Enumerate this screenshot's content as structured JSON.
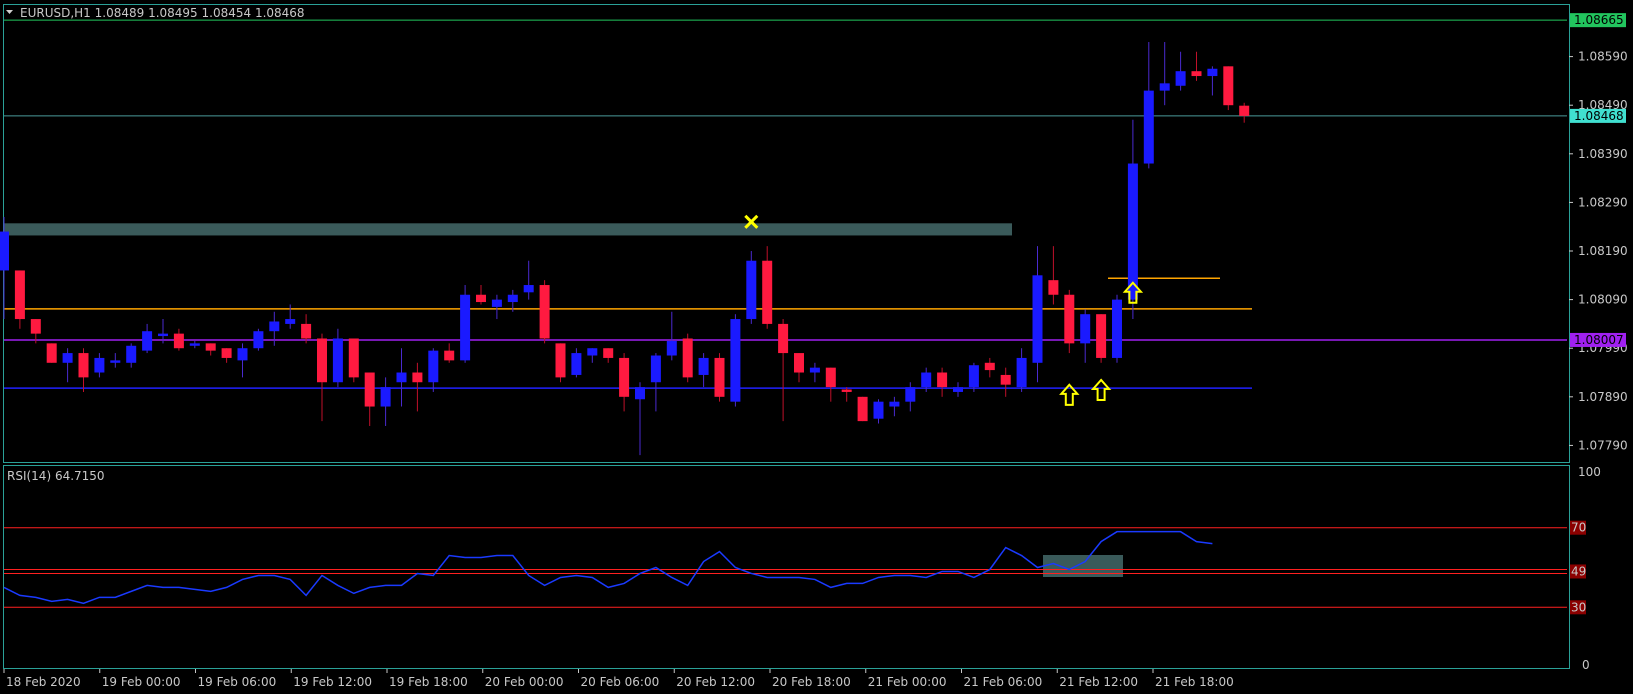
{
  "header": {
    "symbol_line": "EURUSD,H1  1.08489 1.08495 1.08454 1.08468"
  },
  "colors": {
    "background": "#000000",
    "bull_candle": "#1a1aff",
    "bear_candle": "#ff1a40",
    "grid_frame": "#2aa198",
    "support_resistance_zone": "#3a5a5a",
    "orange_level": "#ffa500",
    "purple_level": "#a020f0",
    "blue_level": "#2020ff",
    "bid_line": "#4a9a9a",
    "rsi_line": "#1a3aff",
    "rsi_levels": "#ff2020",
    "arrow_markers": "#ffff00"
  },
  "price_axis": {
    "ticks": [
      "1.08590",
      "1.08490",
      "1.08390",
      "1.08290",
      "1.08190",
      "1.08090",
      "1.07990",
      "1.07890",
      "1.07790"
    ],
    "badges": [
      {
        "label": "1.08665",
        "value": 1.08665,
        "color": "#22c55e"
      },
      {
        "label": "1.08468",
        "value": 1.08468,
        "color": "#40e0d0"
      },
      {
        "label": "1.08007",
        "value": 1.08007,
        "color": "#a020f0"
      }
    ]
  },
  "time_axis": {
    "labels": [
      "18 Feb 2020",
      "19 Feb 00:00",
      "19 Feb 06:00",
      "19 Feb 12:00",
      "19 Feb 18:00",
      "20 Feb 00:00",
      "20 Feb 06:00",
      "20 Feb 12:00",
      "20 Feb 18:00",
      "21 Feb 00:00",
      "21 Feb 06:00",
      "21 Feb 12:00",
      "21 Feb 18:00"
    ]
  },
  "rsi_panel": {
    "label": "RSI(14) 64.7150",
    "scale_ticks": [
      "100",
      "0"
    ],
    "level_badges": [
      "70",
      "49",
      "30"
    ]
  },
  "chart_data": [
    {
      "type": "candlestick",
      "title": "EURUSD,H1",
      "timeframe": "H1",
      "ylim": [
        1.0776,
        1.0869
      ],
      "levels": {
        "green_top": 1.08665,
        "bid": 1.08468,
        "zone": [
          1.08222,
          1.08247
        ],
        "orange": 1.08071,
        "purple": 1.08007,
        "blue": 1.07908,
        "orange_short": 1.08134
      },
      "candles": [
        {
          "t": "18 Feb 17:00",
          "o": 1.0815,
          "h": 1.0826,
          "l": 1.0805,
          "c": 1.0823
        },
        {
          "t": "18 Feb 18:00",
          "o": 1.0815,
          "h": 1.0815,
          "l": 1.0803,
          "c": 1.0805
        },
        {
          "t": "18 Feb 19:00",
          "o": 1.0805,
          "h": 1.0805,
          "l": 1.08,
          "c": 1.0802
        },
        {
          "t": "18 Feb 20:00",
          "o": 1.08,
          "h": 1.08,
          "l": 1.0796,
          "c": 1.0796
        },
        {
          "t": "18 Feb 21:00",
          "o": 1.0796,
          "h": 1.0799,
          "l": 1.0792,
          "c": 1.0798
        },
        {
          "t": "18 Feb 22:00",
          "o": 1.0798,
          "h": 1.0799,
          "l": 1.079,
          "c": 1.0793
        },
        {
          "t": "18 Feb 23:00",
          "o": 1.0794,
          "h": 1.0798,
          "l": 1.0793,
          "c": 1.0797
        },
        {
          "t": "19 Feb 00:00",
          "o": 1.0796,
          "h": 1.0798,
          "l": 1.0795,
          "c": 1.07965
        },
        {
          "t": "19 Feb 01:00",
          "o": 1.0796,
          "h": 1.08,
          "l": 1.0795,
          "c": 1.07995
        },
        {
          "t": "19 Feb 02:00",
          "o": 1.07985,
          "h": 1.0804,
          "l": 1.0798,
          "c": 1.08025
        },
        {
          "t": "19 Feb 03:00",
          "o": 1.08015,
          "h": 1.0805,
          "l": 1.08,
          "c": 1.0802
        },
        {
          "t": "19 Feb 04:00",
          "o": 1.0802,
          "h": 1.0803,
          "l": 1.07985,
          "c": 1.0799
        },
        {
          "t": "19 Feb 05:00",
          "o": 1.07995,
          "h": 1.08005,
          "l": 1.0799,
          "c": 1.08
        },
        {
          "t": "19 Feb 06:00",
          "o": 1.08,
          "h": 1.08,
          "l": 1.07975,
          "c": 1.07985
        },
        {
          "t": "19 Feb 07:00",
          "o": 1.0799,
          "h": 1.0799,
          "l": 1.0796,
          "c": 1.0797
        },
        {
          "t": "19 Feb 08:00",
          "o": 1.07965,
          "h": 1.08,
          "l": 1.0793,
          "c": 1.0799
        },
        {
          "t": "19 Feb 09:00",
          "o": 1.0799,
          "h": 1.0803,
          "l": 1.07985,
          "c": 1.08025
        },
        {
          "t": "19 Feb 10:00",
          "o": 1.08025,
          "h": 1.08065,
          "l": 1.07995,
          "c": 1.08045
        },
        {
          "t": "19 Feb 11:00",
          "o": 1.0804,
          "h": 1.0808,
          "l": 1.0803,
          "c": 1.0805
        },
        {
          "t": "19 Feb 12:00",
          "o": 1.0804,
          "h": 1.0806,
          "l": 1.08,
          "c": 1.0801
        },
        {
          "t": "19 Feb 13:00",
          "o": 1.0801,
          "h": 1.0802,
          "l": 1.0784,
          "c": 1.0792
        },
        {
          "t": "19 Feb 14:00",
          "o": 1.0792,
          "h": 1.0803,
          "l": 1.0791,
          "c": 1.0801
        },
        {
          "t": "19 Feb 15:00",
          "o": 1.0801,
          "h": 1.0801,
          "l": 1.0792,
          "c": 1.0793
        },
        {
          "t": "19 Feb 16:00",
          "o": 1.0794,
          "h": 1.0794,
          "l": 1.0783,
          "c": 1.0787
        },
        {
          "t": "19 Feb 17:00",
          "o": 1.0787,
          "h": 1.0793,
          "l": 1.0783,
          "c": 1.0791
        },
        {
          "t": "19 Feb 18:00",
          "o": 1.0792,
          "h": 1.0799,
          "l": 1.0787,
          "c": 1.0794
        },
        {
          "t": "19 Feb 19:00",
          "o": 1.0794,
          "h": 1.0796,
          "l": 1.0786,
          "c": 1.0792
        },
        {
          "t": "19 Feb 20:00",
          "o": 1.0792,
          "h": 1.0799,
          "l": 1.079,
          "c": 1.07985
        },
        {
          "t": "19 Feb 21:00",
          "o": 1.07985,
          "h": 1.08,
          "l": 1.0796,
          "c": 1.07965
        },
        {
          "t": "19 Feb 22:00",
          "o": 1.07965,
          "h": 1.0812,
          "l": 1.0796,
          "c": 1.081
        },
        {
          "t": "19 Feb 23:00",
          "o": 1.081,
          "h": 1.0812,
          "l": 1.0808,
          "c": 1.08085
        },
        {
          "t": "20 Feb 00:00",
          "o": 1.08075,
          "h": 1.081,
          "l": 1.0805,
          "c": 1.0809
        },
        {
          "t": "20 Feb 01:00",
          "o": 1.08085,
          "h": 1.0811,
          "l": 1.08065,
          "c": 1.081
        },
        {
          "t": "20 Feb 02:00",
          "o": 1.08105,
          "h": 1.0817,
          "l": 1.0809,
          "c": 1.0812
        },
        {
          "t": "20 Feb 03:00",
          "o": 1.0812,
          "h": 1.0813,
          "l": 1.08,
          "c": 1.0801
        },
        {
          "t": "20 Feb 04:00",
          "o": 1.08,
          "h": 1.08,
          "l": 1.0792,
          "c": 1.0793
        },
        {
          "t": "20 Feb 05:00",
          "o": 1.07935,
          "h": 1.0799,
          "l": 1.0793,
          "c": 1.0798
        },
        {
          "t": "20 Feb 06:00",
          "o": 1.07975,
          "h": 1.0799,
          "l": 1.0796,
          "c": 1.0799
        },
        {
          "t": "20 Feb 07:00",
          "o": 1.0799,
          "h": 1.0799,
          "l": 1.0796,
          "c": 1.0797
        },
        {
          "t": "20 Feb 08:00",
          "o": 1.0797,
          "h": 1.0798,
          "l": 1.0786,
          "c": 1.0789
        },
        {
          "t": "20 Feb 09:00",
          "o": 1.07885,
          "h": 1.0792,
          "l": 1.0777,
          "c": 1.0791
        },
        {
          "t": "20 Feb 10:00",
          "o": 1.0792,
          "h": 1.0798,
          "l": 1.0786,
          "c": 1.07975
        },
        {
          "t": "20 Feb 11:00",
          "o": 1.07975,
          "h": 1.08065,
          "l": 1.07965,
          "c": 1.08005
        },
        {
          "t": "20 Feb 12:00",
          "o": 1.0801,
          "h": 1.0802,
          "l": 1.0792,
          "c": 1.0793
        },
        {
          "t": "20 Feb 13:00",
          "o": 1.07935,
          "h": 1.0798,
          "l": 1.0791,
          "c": 1.0797
        },
        {
          "t": "20 Feb 14:00",
          "o": 1.0797,
          "h": 1.0798,
          "l": 1.0788,
          "c": 1.0789
        },
        {
          "t": "20 Feb 15:00",
          "o": 1.0788,
          "h": 1.0806,
          "l": 1.0787,
          "c": 1.0805
        },
        {
          "t": "20 Feb 16:00",
          "o": 1.0805,
          "h": 1.0819,
          "l": 1.0804,
          "c": 1.0817
        },
        {
          "t": "20 Feb 17:00",
          "o": 1.0817,
          "h": 1.082,
          "l": 1.0803,
          "c": 1.0804
        },
        {
          "t": "20 Feb 18:00",
          "o": 1.0804,
          "h": 1.0805,
          "l": 1.0784,
          "c": 1.0798
        },
        {
          "t": "20 Feb 19:00",
          "o": 1.0798,
          "h": 1.0798,
          "l": 1.0792,
          "c": 1.0794
        },
        {
          "t": "20 Feb 20:00",
          "o": 1.0794,
          "h": 1.0796,
          "l": 1.0792,
          "c": 1.0795
        },
        {
          "t": "20 Feb 21:00",
          "o": 1.0795,
          "h": 1.0795,
          "l": 1.0788,
          "c": 1.0791
        },
        {
          "t": "20 Feb 22:00",
          "o": 1.07905,
          "h": 1.0791,
          "l": 1.0788,
          "c": 1.079
        },
        {
          "t": "20 Feb 23:00",
          "o": 1.0789,
          "h": 1.0789,
          "l": 1.0784,
          "c": 1.0784
        },
        {
          "t": "21 Feb 00:00",
          "o": 1.07845,
          "h": 1.07885,
          "l": 1.07835,
          "c": 1.0788
        },
        {
          "t": "21 Feb 01:00",
          "o": 1.0787,
          "h": 1.0789,
          "l": 1.0785,
          "c": 1.0788
        },
        {
          "t": "21 Feb 02:00",
          "o": 1.0788,
          "h": 1.0792,
          "l": 1.0786,
          "c": 1.0791
        },
        {
          "t": "21 Feb 03:00",
          "o": 1.0791,
          "h": 1.0795,
          "l": 1.079,
          "c": 1.0794
        },
        {
          "t": "21 Feb 04:00",
          "o": 1.0794,
          "h": 1.0795,
          "l": 1.0789,
          "c": 1.0791
        },
        {
          "t": "21 Feb 05:00",
          "o": 1.079,
          "h": 1.0792,
          "l": 1.0789,
          "c": 1.0791
        },
        {
          "t": "21 Feb 06:00",
          "o": 1.0791,
          "h": 1.0796,
          "l": 1.079,
          "c": 1.07955
        },
        {
          "t": "21 Feb 07:00",
          "o": 1.0796,
          "h": 1.0797,
          "l": 1.0793,
          "c": 1.07945
        },
        {
          "t": "21 Feb 08:00",
          "o": 1.07935,
          "h": 1.0795,
          "l": 1.0789,
          "c": 1.07915
        },
        {
          "t": "21 Feb 09:00",
          "o": 1.0791,
          "h": 1.0799,
          "l": 1.079,
          "c": 1.0797
        },
        {
          "t": "21 Feb 10:00",
          "o": 1.0796,
          "h": 1.082,
          "l": 1.0792,
          "c": 1.0814
        },
        {
          "t": "21 Feb 11:00",
          "o": 1.0813,
          "h": 1.082,
          "l": 1.0808,
          "c": 1.081
        },
        {
          "t": "21 Feb 12:00",
          "o": 1.081,
          "h": 1.0811,
          "l": 1.0798,
          "c": 1.08
        },
        {
          "t": "21 Feb 13:00",
          "o": 1.08,
          "h": 1.0807,
          "l": 1.0796,
          "c": 1.0806
        },
        {
          "t": "21 Feb 14:00",
          "o": 1.0806,
          "h": 1.0806,
          "l": 1.0796,
          "c": 1.0797
        },
        {
          "t": "21 Feb 15:00",
          "o": 1.0797,
          "h": 1.081,
          "l": 1.0796,
          "c": 1.0809
        },
        {
          "t": "21 Feb 16:00",
          "o": 1.0809,
          "h": 1.0846,
          "l": 1.0805,
          "c": 1.0837
        },
        {
          "t": "21 Feb 17:00",
          "o": 1.0837,
          "h": 1.0862,
          "l": 1.0836,
          "c": 1.0852
        },
        {
          "t": "21 Feb 18:00",
          "o": 1.0852,
          "h": 1.0862,
          "l": 1.0849,
          "c": 1.08535
        },
        {
          "t": "21 Feb 19:00",
          "o": 1.0853,
          "h": 1.086,
          "l": 1.0852,
          "c": 1.0856
        },
        {
          "t": "21 Feb 20:00",
          "o": 1.0856,
          "h": 1.086,
          "l": 1.0854,
          "c": 1.0855
        },
        {
          "t": "21 Feb 21:00",
          "o": 1.0855,
          "h": 1.0857,
          "l": 1.0851,
          "c": 1.08565
        },
        {
          "t": "21 Feb 22:00",
          "o": 1.0857,
          "h": 1.0857,
          "l": 1.0848,
          "c": 1.0849
        },
        {
          "t": "21 Feb 23:00",
          "o": 1.08489,
          "h": 1.08495,
          "l": 1.08454,
          "c": 1.08468
        }
      ],
      "markers": [
        {
          "type": "cross",
          "t": "20 Feb 16:00",
          "price": 1.0825
        },
        {
          "type": "arrow-up",
          "t": "21 Feb 12:00",
          "price": 1.0789
        },
        {
          "type": "arrow-up",
          "t": "21 Feb 14:00",
          "price": 1.079
        },
        {
          "type": "arrow-up",
          "t": "21 Feb 16:00",
          "price": 1.081
        }
      ]
    },
    {
      "type": "line",
      "title": "RSI(14) 64.7150",
      "ylim": [
        0,
        100
      ],
      "levels": [
        70,
        49,
        47,
        30
      ],
      "series": [
        {
          "name": "RSI(14)",
          "values": [
            40,
            36,
            35,
            33,
            34,
            32,
            35,
            35,
            38,
            41,
            40,
            40,
            39,
            38,
            40,
            44,
            46,
            46,
            44,
            36,
            46,
            41,
            37,
            40,
            41,
            41,
            47,
            46,
            56,
            55,
            55,
            56,
            56,
            46,
            41,
            45,
            46,
            45,
            40,
            42,
            47,
            50,
            45,
            41,
            53,
            58,
            50,
            47,
            45,
            45,
            45,
            44,
            40,
            42,
            42,
            45,
            46,
            46,
            45,
            48,
            48,
            45,
            49,
            60,
            56,
            50,
            52,
            49,
            53,
            63,
            68,
            68,
            68,
            68,
            68,
            63,
            62
          ]
        }
      ]
    }
  ]
}
